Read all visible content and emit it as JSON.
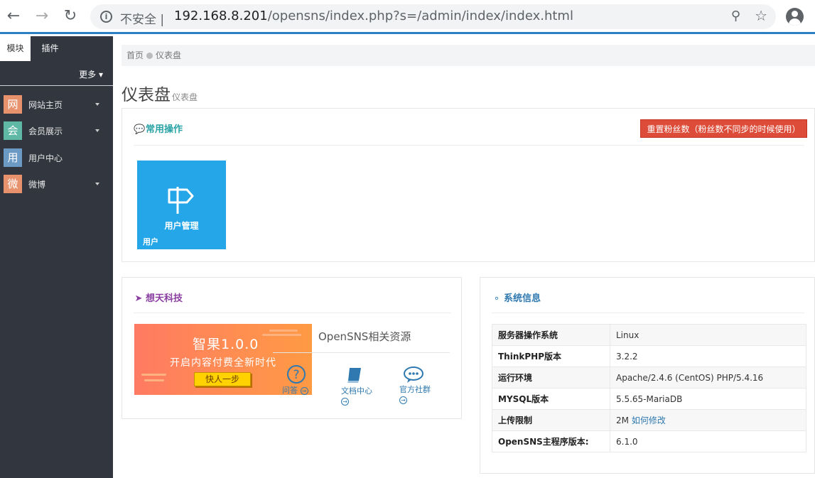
{
  "browser": {
    "insecure_label": "不安全",
    "url_host": "192.168.8.201",
    "url_path": "/opensns/index.php?s=/admin/index/index.html"
  },
  "sidebar": {
    "tabs": [
      "模块",
      "插件"
    ],
    "more_label": "更多",
    "items": [
      {
        "badge": "网",
        "label": "网站主页",
        "color": "#e8926d",
        "has_caret": true
      },
      {
        "badge": "会",
        "label": "会员展示",
        "color": "#5fb8a6",
        "has_caret": true
      },
      {
        "badge": "用",
        "label": "用户中心",
        "color": "#6b9ac4",
        "has_caret": false
      },
      {
        "badge": "微",
        "label": "微博",
        "color": "#e8926d",
        "has_caret": true
      }
    ]
  },
  "breadcrumb": {
    "home": "首页",
    "current": "仪表盘"
  },
  "page": {
    "title": "仪表盘",
    "subtitle": "仪表盘"
  },
  "common_ops": {
    "title": "常用操作",
    "reset_button": "重置粉丝数（粉丝数不同步的时候使用）",
    "tile": {
      "name": "用户管理",
      "category": "用户",
      "color": "#24a6e8"
    }
  },
  "company": {
    "title": "想天科技",
    "banner": {
      "title": "智果1.0.0",
      "subtitle": "开启内容付费全新时代",
      "button": "快人一步"
    },
    "resources_title": "OpenSNS相关资源",
    "links": {
      "qa": "问答",
      "docs": "文档中心",
      "community": "官方社群"
    }
  },
  "system": {
    "title": "系统信息",
    "rows": [
      {
        "key": "服务器操作系统",
        "value": "Linux"
      },
      {
        "key": "ThinkPHP版本",
        "value": "3.2.2"
      },
      {
        "key": "运行环境",
        "value": "Apache/2.4.6 (CentOS) PHP/5.4.16"
      },
      {
        "key": "MYSQL版本",
        "value": "5.5.65-MariaDB"
      },
      {
        "key": "上传限制",
        "value": "2M",
        "link": "如何修改"
      },
      {
        "key": "OpenSNS主程序版本:",
        "value": "6.1.0"
      }
    ]
  },
  "colors": {
    "accent": "#2b7fc4",
    "danger": "#dd4b39",
    "sidebar_bg": "#32373f",
    "teal_title": "#2aa3a6",
    "purple_title": "#8a3fa0",
    "blue_title": "#2f79b0"
  }
}
